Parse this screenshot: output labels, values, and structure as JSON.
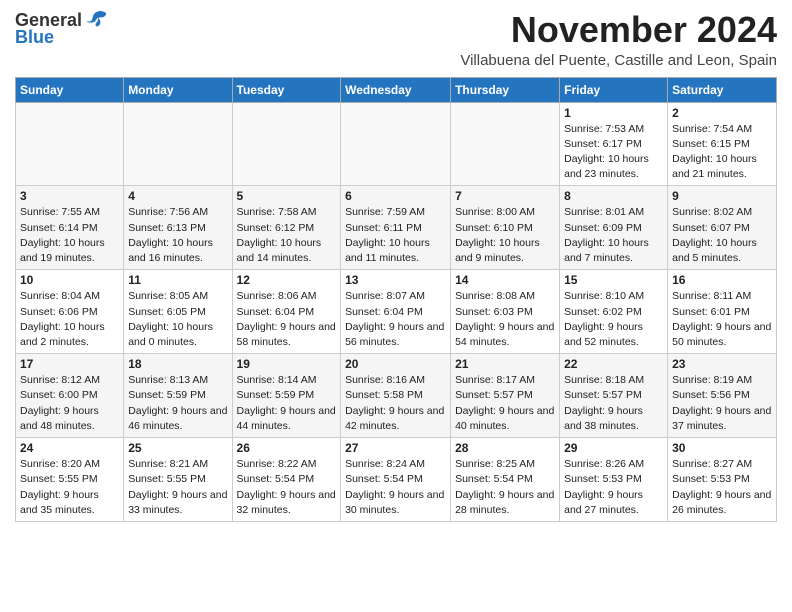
{
  "logo": {
    "line1": "General",
    "line2": "Blue",
    "bird_unicode": "🐦"
  },
  "title": "November 2024",
  "location": "Villabuena del Puente, Castille and Leon, Spain",
  "weekdays": [
    "Sunday",
    "Monday",
    "Tuesday",
    "Wednesday",
    "Thursday",
    "Friday",
    "Saturday"
  ],
  "weeks": [
    [
      {
        "day": "",
        "info": ""
      },
      {
        "day": "",
        "info": ""
      },
      {
        "day": "",
        "info": ""
      },
      {
        "day": "",
        "info": ""
      },
      {
        "day": "",
        "info": ""
      },
      {
        "day": "1",
        "info": "Sunrise: 7:53 AM\nSunset: 6:17 PM\nDaylight: 10 hours and 23 minutes."
      },
      {
        "day": "2",
        "info": "Sunrise: 7:54 AM\nSunset: 6:15 PM\nDaylight: 10 hours and 21 minutes."
      }
    ],
    [
      {
        "day": "3",
        "info": "Sunrise: 7:55 AM\nSunset: 6:14 PM\nDaylight: 10 hours and 19 minutes."
      },
      {
        "day": "4",
        "info": "Sunrise: 7:56 AM\nSunset: 6:13 PM\nDaylight: 10 hours and 16 minutes."
      },
      {
        "day": "5",
        "info": "Sunrise: 7:58 AM\nSunset: 6:12 PM\nDaylight: 10 hours and 14 minutes."
      },
      {
        "day": "6",
        "info": "Sunrise: 7:59 AM\nSunset: 6:11 PM\nDaylight: 10 hours and 11 minutes."
      },
      {
        "day": "7",
        "info": "Sunrise: 8:00 AM\nSunset: 6:10 PM\nDaylight: 10 hours and 9 minutes."
      },
      {
        "day": "8",
        "info": "Sunrise: 8:01 AM\nSunset: 6:09 PM\nDaylight: 10 hours and 7 minutes."
      },
      {
        "day": "9",
        "info": "Sunrise: 8:02 AM\nSunset: 6:07 PM\nDaylight: 10 hours and 5 minutes."
      }
    ],
    [
      {
        "day": "10",
        "info": "Sunrise: 8:04 AM\nSunset: 6:06 PM\nDaylight: 10 hours and 2 minutes."
      },
      {
        "day": "11",
        "info": "Sunrise: 8:05 AM\nSunset: 6:05 PM\nDaylight: 10 hours and 0 minutes."
      },
      {
        "day": "12",
        "info": "Sunrise: 8:06 AM\nSunset: 6:04 PM\nDaylight: 9 hours and 58 minutes."
      },
      {
        "day": "13",
        "info": "Sunrise: 8:07 AM\nSunset: 6:04 PM\nDaylight: 9 hours and 56 minutes."
      },
      {
        "day": "14",
        "info": "Sunrise: 8:08 AM\nSunset: 6:03 PM\nDaylight: 9 hours and 54 minutes."
      },
      {
        "day": "15",
        "info": "Sunrise: 8:10 AM\nSunset: 6:02 PM\nDaylight: 9 hours and 52 minutes."
      },
      {
        "day": "16",
        "info": "Sunrise: 8:11 AM\nSunset: 6:01 PM\nDaylight: 9 hours and 50 minutes."
      }
    ],
    [
      {
        "day": "17",
        "info": "Sunrise: 8:12 AM\nSunset: 6:00 PM\nDaylight: 9 hours and 48 minutes."
      },
      {
        "day": "18",
        "info": "Sunrise: 8:13 AM\nSunset: 5:59 PM\nDaylight: 9 hours and 46 minutes."
      },
      {
        "day": "19",
        "info": "Sunrise: 8:14 AM\nSunset: 5:59 PM\nDaylight: 9 hours and 44 minutes."
      },
      {
        "day": "20",
        "info": "Sunrise: 8:16 AM\nSunset: 5:58 PM\nDaylight: 9 hours and 42 minutes."
      },
      {
        "day": "21",
        "info": "Sunrise: 8:17 AM\nSunset: 5:57 PM\nDaylight: 9 hours and 40 minutes."
      },
      {
        "day": "22",
        "info": "Sunrise: 8:18 AM\nSunset: 5:57 PM\nDaylight: 9 hours and 38 minutes."
      },
      {
        "day": "23",
        "info": "Sunrise: 8:19 AM\nSunset: 5:56 PM\nDaylight: 9 hours and 37 minutes."
      }
    ],
    [
      {
        "day": "24",
        "info": "Sunrise: 8:20 AM\nSunset: 5:55 PM\nDaylight: 9 hours and 35 minutes."
      },
      {
        "day": "25",
        "info": "Sunrise: 8:21 AM\nSunset: 5:55 PM\nDaylight: 9 hours and 33 minutes."
      },
      {
        "day": "26",
        "info": "Sunrise: 8:22 AM\nSunset: 5:54 PM\nDaylight: 9 hours and 32 minutes."
      },
      {
        "day": "27",
        "info": "Sunrise: 8:24 AM\nSunset: 5:54 PM\nDaylight: 9 hours and 30 minutes."
      },
      {
        "day": "28",
        "info": "Sunrise: 8:25 AM\nSunset: 5:54 PM\nDaylight: 9 hours and 28 minutes."
      },
      {
        "day": "29",
        "info": "Sunrise: 8:26 AM\nSunset: 5:53 PM\nDaylight: 9 hours and 27 minutes."
      },
      {
        "day": "30",
        "info": "Sunrise: 8:27 AM\nSunset: 5:53 PM\nDaylight: 9 hours and 26 minutes."
      }
    ]
  ]
}
